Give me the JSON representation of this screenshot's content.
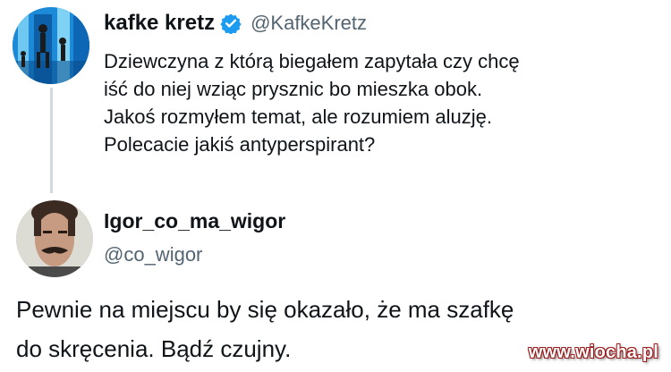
{
  "tweet": {
    "author_name": "kafke kretz",
    "author_handle": "@KafkeKretz",
    "verified_icon": "verified-badge-icon",
    "text_lines": [
      "Dziewczyna z którą biegałem zapytała czy chcę",
      "iść do niej wziąc prysznic bo mieszka obok.",
      "Jakoś rozmyłem temat, ale rozumiem aluzję.",
      "Polecacie jakiś antyperspirant?"
    ]
  },
  "reply": {
    "author_name": "Igor_co_ma_wigor",
    "author_handle": "@co_wigor",
    "text_lines": [
      "Pewnie na miejscu by się okazało,  że ma szafkę",
      "do skręcenia. Bądź czujny."
    ]
  },
  "watermark": "www.wiocha.pl",
  "colors": {
    "text": "#0f1419",
    "secondary_text": "#536471",
    "verified_blue": "#1d9bf0",
    "watermark_outline": "#9b1c1c"
  }
}
